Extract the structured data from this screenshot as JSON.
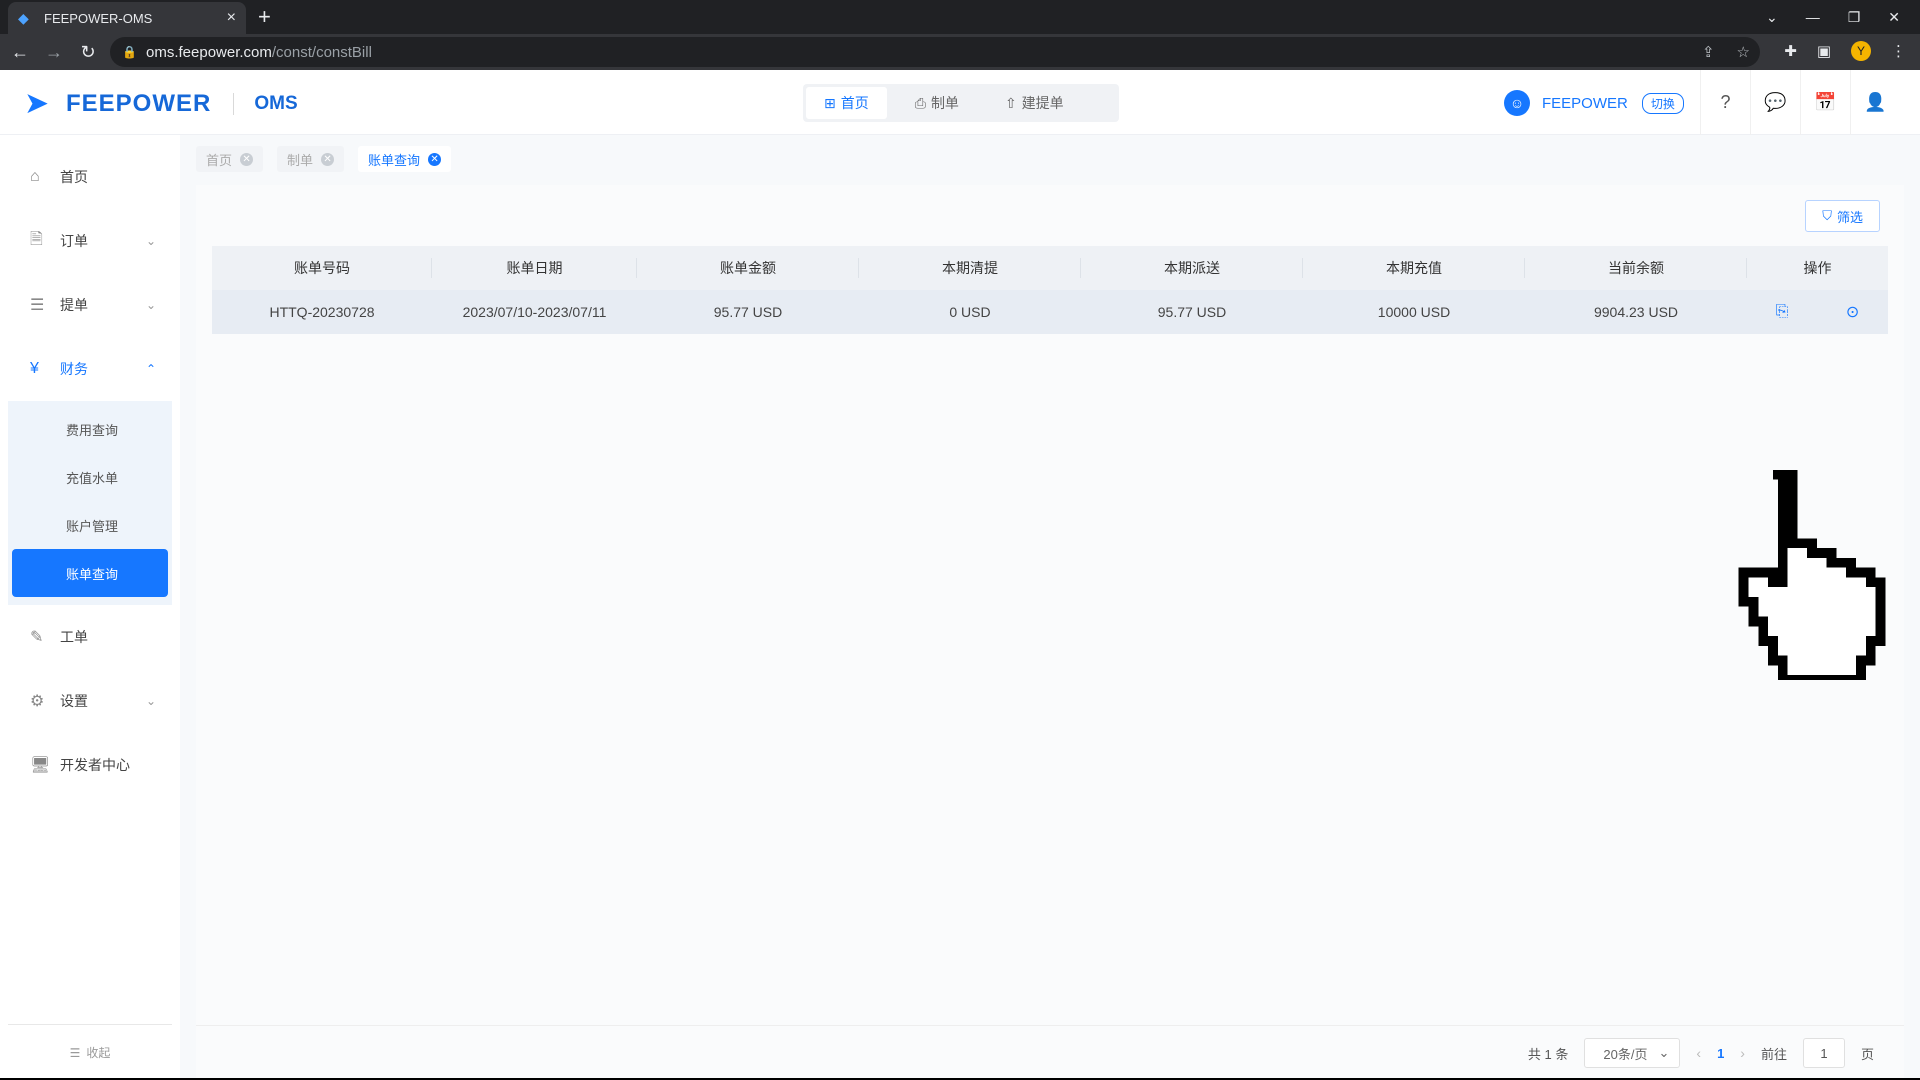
{
  "browser": {
    "tab_title": "FEEPOWER-OMS",
    "close_glyph": "×",
    "newtab_glyph": "+",
    "url_host": "oms.feepower.com",
    "url_path": "/const/constBill",
    "profile_initial": "Y"
  },
  "header": {
    "brand": "FEEPOWER",
    "product": "OMS",
    "tabs": [
      {
        "label": "首页",
        "icon": "grid-icon"
      },
      {
        "label": "制单",
        "icon": "print-icon"
      },
      {
        "label": "建提单",
        "icon": "file-upload-icon"
      }
    ],
    "account_name": "FEEPOWER",
    "switch_label": "切换"
  },
  "sidebar": {
    "items": [
      {
        "label": "首页",
        "icon": "home-icon"
      },
      {
        "label": "订单",
        "icon": "document-icon"
      },
      {
        "label": "提单",
        "icon": "list-doc-icon"
      },
      {
        "label": "财务",
        "icon": "yuan-icon"
      },
      {
        "label": "工单",
        "icon": "ticket-icon"
      },
      {
        "label": "设置",
        "icon": "gear-icon"
      },
      {
        "label": "开发者中心",
        "icon": "monitor-icon"
      }
    ],
    "finance_sub": [
      "费用查询",
      "充值水单",
      "账户管理",
      "账单查询"
    ],
    "collapse_label": "收起"
  },
  "tags": [
    {
      "label": "首页",
      "active": false
    },
    {
      "label": "制单",
      "active": false
    },
    {
      "label": "账单查询",
      "active": true
    }
  ],
  "toolbar": {
    "filter_label": "筛选"
  },
  "table": {
    "columns": [
      "账单号码",
      "账单日期",
      "账单金额",
      "本期清提",
      "本期派送",
      "本期充值",
      "当前余额",
      "操作"
    ],
    "rows": [
      [
        "HTTQ-20230728",
        "2023/07/10-2023/07/11",
        "95.77 USD",
        "0 USD",
        "95.77 USD",
        "10000 USD",
        "9904.23 USD"
      ]
    ]
  },
  "pagination": {
    "total": "共 1 条",
    "page_size": "20条/页",
    "current_page": "1",
    "goto_label": "前往",
    "goto_value": "1",
    "page_suffix": "页"
  },
  "colors": {
    "accent": "#1677ff",
    "sidebar_active": "#1677ff"
  }
}
